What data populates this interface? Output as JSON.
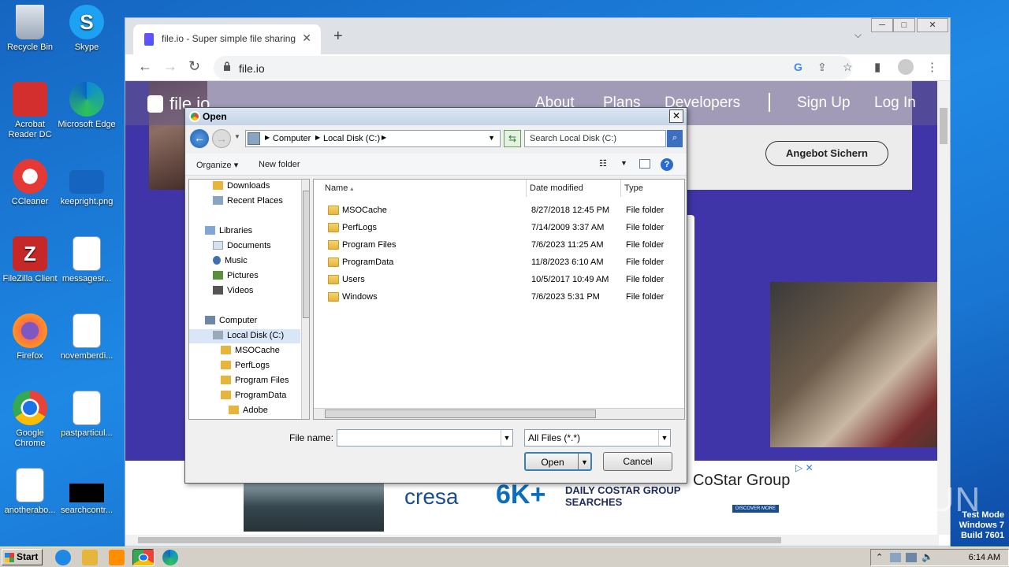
{
  "desktop": {
    "icons": [
      {
        "label": "Recycle Bin"
      },
      {
        "label": "Skype"
      },
      {
        "label": "Acrobat Reader DC"
      },
      {
        "label": "Microsoft Edge"
      },
      {
        "label": "CCleaner"
      },
      {
        "label": "keepright.png"
      },
      {
        "label": "FileZilla Client"
      },
      {
        "label": "messagesr..."
      },
      {
        "label": "Firefox"
      },
      {
        "label": "novemberdi..."
      },
      {
        "label": "Google Chrome"
      },
      {
        "label": "pastparticul..."
      },
      {
        "label": "anotherabo..."
      },
      {
        "label": "searchcontr..."
      }
    ],
    "watermark": "ANY RUN",
    "test_mode": [
      "Test Mode",
      "Windows 7",
      "Build 7601"
    ]
  },
  "taskbar": {
    "start_label": "Start",
    "clock": "6:14 AM"
  },
  "browser": {
    "tab_title": "file.io - Super simple file sharing",
    "url": "file.io",
    "window_controls": [
      "─",
      "□",
      "✕"
    ]
  },
  "site": {
    "logo": "file.io",
    "nav": [
      "About",
      "Plans",
      "Developers",
      "Sign Up",
      "Log In"
    ],
    "offer_button": "Angebot Sichern"
  },
  "ad": {
    "brand": "cresa",
    "headline": "6K+",
    "subline_1": "DAILY COSTAR GROUP",
    "subline_2": "SEARCHES",
    "sponsor": "CoStar Group",
    "cta": "DISCOVER MORE"
  },
  "dialog": {
    "title": "Open",
    "breadcrumb": [
      "Computer",
      "Local Disk (C:)"
    ],
    "search_placeholder": "Search Local Disk (C:)",
    "commands": {
      "organize": "Organize",
      "new_folder": "New folder"
    },
    "nav_tree": [
      {
        "label": "Downloads"
      },
      {
        "label": "Recent Places"
      },
      {
        "label": "Libraries"
      },
      {
        "label": "Documents"
      },
      {
        "label": "Music"
      },
      {
        "label": "Pictures"
      },
      {
        "label": "Videos"
      },
      {
        "label": "Computer"
      },
      {
        "label": "Local Disk (C:)"
      },
      {
        "label": "MSOCache"
      },
      {
        "label": "PerfLogs"
      },
      {
        "label": "Program Files"
      },
      {
        "label": "ProgramData"
      },
      {
        "label": "Adobe"
      }
    ],
    "columns": {
      "name": "Name",
      "date": "Date modified",
      "type": "Type"
    },
    "files": [
      {
        "name": "MSOCache",
        "date": "8/27/2018 12:45 PM",
        "type": "File folder"
      },
      {
        "name": "PerfLogs",
        "date": "7/14/2009 3:37 AM",
        "type": "File folder"
      },
      {
        "name": "Program Files",
        "date": "7/6/2023 11:25 AM",
        "type": "File folder"
      },
      {
        "name": "ProgramData",
        "date": "11/8/2023 6:10 AM",
        "type": "File folder"
      },
      {
        "name": "Users",
        "date": "10/5/2017 10:49 AM",
        "type": "File folder"
      },
      {
        "name": "Windows",
        "date": "7/6/2023 5:31 PM",
        "type": "File folder"
      }
    ],
    "file_name_label": "File name:",
    "file_name_value": "",
    "filter": "All Files (*.*)",
    "open_label": "Open",
    "cancel_label": "Cancel"
  }
}
